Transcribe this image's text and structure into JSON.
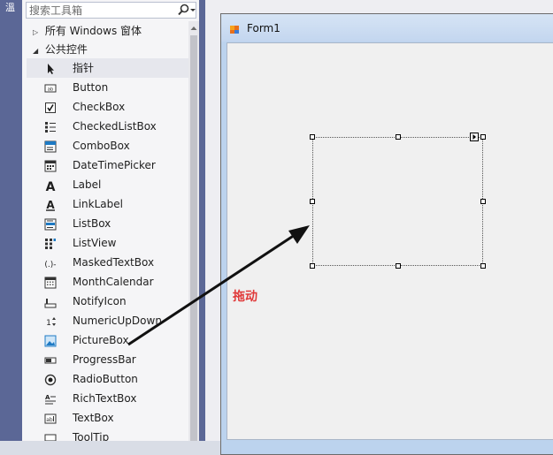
{
  "left_strip": {
    "label": "溫"
  },
  "toolbox": {
    "search": {
      "placeholder": "搜索工具箱",
      "value": ""
    },
    "groups": [
      {
        "label": "所有 Windows 窗体",
        "expanded": false
      },
      {
        "label": "公共控件",
        "expanded": true
      }
    ],
    "items": [
      {
        "label": "指针",
        "icon": "pointer-icon",
        "selected": true
      },
      {
        "label": "Button",
        "icon": "button-icon"
      },
      {
        "label": "CheckBox",
        "icon": "checkbox-icon"
      },
      {
        "label": "CheckedListBox",
        "icon": "checkedlistbox-icon"
      },
      {
        "label": "ComboBox",
        "icon": "combobox-icon"
      },
      {
        "label": "DateTimePicker",
        "icon": "datetimepicker-icon"
      },
      {
        "label": "Label",
        "icon": "label-icon"
      },
      {
        "label": "LinkLabel",
        "icon": "linklabel-icon"
      },
      {
        "label": "ListBox",
        "icon": "listbox-icon"
      },
      {
        "label": "ListView",
        "icon": "listview-icon"
      },
      {
        "label": "MaskedTextBox",
        "icon": "maskedtextbox-icon"
      },
      {
        "label": "MonthCalendar",
        "icon": "monthcalendar-icon"
      },
      {
        "label": "NotifyIcon",
        "icon": "notifyicon-icon"
      },
      {
        "label": "NumericUpDown",
        "icon": "numericupdown-icon"
      },
      {
        "label": "PictureBox",
        "icon": "picturebox-icon"
      },
      {
        "label": "ProgressBar",
        "icon": "progressbar-icon"
      },
      {
        "label": "RadioButton",
        "icon": "radiobutton-icon"
      },
      {
        "label": "RichTextBox",
        "icon": "richtextbox-icon"
      },
      {
        "label": "TextBox",
        "icon": "textbox-icon"
      },
      {
        "label": "ToolTip",
        "icon": "tooltip-icon"
      }
    ]
  },
  "designer": {
    "form_title": "Form1",
    "annotation": "拖动"
  },
  "colors": {
    "accent_strip": "#5b6796",
    "annotation": "#e03a3a",
    "form_titlebar": "#c3d6ef"
  }
}
